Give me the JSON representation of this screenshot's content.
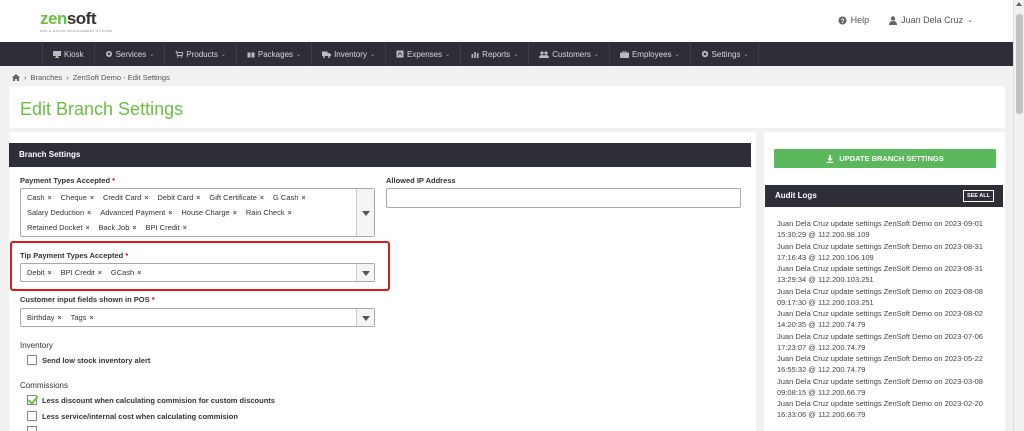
{
  "brand": {
    "name_part1": "zen",
    "name_part2": "soft",
    "tagline": "SPA & SALON MANAGEMENT SYSTEM"
  },
  "topbar": {
    "help_label": "Help",
    "user_name": "Juan Dela Cruz"
  },
  "nav": {
    "items": [
      {
        "label": "Kiosk",
        "icon": "desktop-icon",
        "has_caret": false
      },
      {
        "label": "Services",
        "icon": "gear-icon",
        "has_caret": true
      },
      {
        "label": "Products",
        "icon": "cart-icon",
        "has_caret": true
      },
      {
        "label": "Packages",
        "icon": "gift-icon",
        "has_caret": true
      },
      {
        "label": "Inventory",
        "icon": "truck-icon",
        "has_caret": true
      },
      {
        "label": "Expenses",
        "icon": "receipt-icon",
        "has_caret": true
      },
      {
        "label": "Reports",
        "icon": "bar-chart-icon",
        "has_caret": true
      },
      {
        "label": "Customers",
        "icon": "users-icon",
        "has_caret": true
      },
      {
        "label": "Employees",
        "icon": "employees-icon",
        "has_caret": true
      },
      {
        "label": "Settings",
        "icon": "settings-icon",
        "has_caret": true
      }
    ]
  },
  "breadcrumb": {
    "items": [
      "Branches",
      "ZenSoft Demo - Edit Settings"
    ]
  },
  "page": {
    "title": "Edit Branch Settings"
  },
  "branch_settings": {
    "header": "Branch Settings",
    "payment_types": {
      "label": "Payment Types Accepted",
      "required": "*",
      "tags": [
        "Cash",
        "Cheque",
        "Credit Card",
        "Debit Card",
        "Gift Certificate",
        "G Cash",
        "Salary Deduction",
        "Advanced Payment",
        "House Charge",
        "Rain Check",
        "Retained Docket",
        "Back Job",
        "BPI Credit"
      ]
    },
    "allowed_ip": {
      "label": "Allowed IP Address",
      "value": ""
    },
    "tip_payment_types": {
      "label": "Tip Payment Types Accepted",
      "required": "*",
      "tags": [
        "Debit",
        "BPI Credit",
        "GCash"
      ]
    },
    "customer_fields": {
      "label": "Customer input fields shown in POS",
      "required": "*",
      "tags": [
        "Birthday",
        "Tags"
      ]
    },
    "inventory": {
      "title": "Inventory",
      "low_stock_label": "Send low stock inventory alert",
      "low_stock_checked": false
    },
    "commissions": {
      "title": "Commissions",
      "less_discount_label": "Less discount when calculating commision for custom discounts",
      "less_discount_checked": true,
      "less_service_label": "Less service/internal cost when calculating commision",
      "less_service_checked": false
    },
    "remove_tag_glyph": "×"
  },
  "sidebar": {
    "update_button_label": "UPDATE BRANCH SETTINGS",
    "audit_title": "Audit Logs",
    "see_all_label": "SEE ALL",
    "logs": [
      "Juan Dela Cruz update settings ZenSoft Demo on 2023-09-01 15:30:29 @ 112.200.98.109",
      "Juan Dela Cruz update settings ZenSoft Demo on 2023-08-31 17:16:43 @ 112.200.106.109",
      "Juan Dela Cruz update settings ZenSoft Demo on 2023-08-31 13:29:34 @ 112.200.103.251",
      "Juan Dela Cruz update settings ZenSoft Demo on 2023-08-08 09:17:30 @ 112.200.103.251",
      "Juan Dela Cruz update settings ZenSoft Demo on 2023-08-02 14:20:35 @ 112.200.74.79",
      "Juan Dela Cruz update settings ZenSoft Demo on 2023-07-06 17:23:07 @ 112.200.74.79",
      "Juan Dela Cruz update settings ZenSoft Demo on 2023-05-22 16:55:32 @ 112.200.74.79",
      "Juan Dela Cruz update settings ZenSoft Demo on 2023-03-08 09:08:15 @ 112.200.66.79",
      "Juan Dela Cruz update settings ZenSoft Demo on 2023-02-20 16:33:06 @ 112.200.66.79"
    ]
  },
  "colors": {
    "brand_green": "#6abf3f",
    "nav_dark": "#2e2e38",
    "button_green": "#5cb85c",
    "highlight_red": "#e0181b"
  }
}
